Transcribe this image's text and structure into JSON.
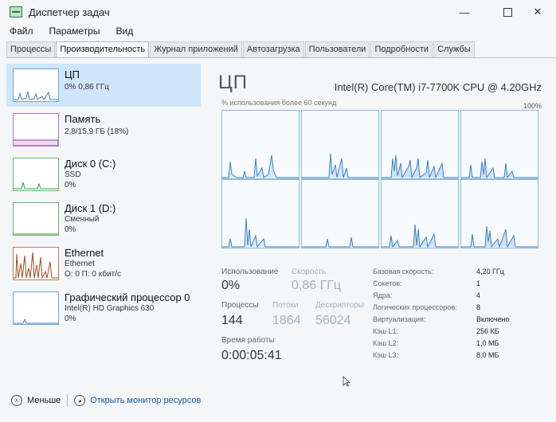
{
  "window": {
    "title": "Диспетчер задач"
  },
  "menu": [
    "Файл",
    "Параметры",
    "Вид"
  ],
  "tabs": [
    "Процессы",
    "Производительность",
    "Журнал приложений",
    "Автозагрузка",
    "Пользователи",
    "Подробности",
    "Службы"
  ],
  "active_tab": 1,
  "sidebar": [
    {
      "name": "ЦП",
      "lines": [
        "0% 0,86 ГГц"
      ],
      "active": true,
      "graph_color": "#3a7fc4"
    },
    {
      "name": "Память",
      "lines": [
        "2,8/15,9 ГБ (18%)"
      ],
      "graph_color": "#8b3aa0"
    },
    {
      "name": "Диск 0 (C:)",
      "lines": [
        "SSD",
        "0%"
      ],
      "graph_color": "#3e9a3e"
    },
    {
      "name": "Диск 1 (D:)",
      "lines": [
        "Сменный",
        "0%"
      ],
      "graph_color": "#3e9a3e"
    },
    {
      "name": "Ethernet",
      "lines": [
        "Ethernet",
        "О: 0 П: 0 кбит/с"
      ],
      "graph_color": "#a04a20"
    },
    {
      "name": "Графический процессор 0",
      "lines": [
        "Intel(R) HD Graphics 630",
        "0%"
      ],
      "graph_color": "#3a7fc4"
    }
  ],
  "main": {
    "title": "ЦП",
    "cpu_name": "Intel(R) Core(TM) i7-7700K CPU @ 4.20GHz",
    "graph_caption": "% использования более 60 секунд",
    "graph_max": "100%",
    "stats": {
      "usage_label": "Использование",
      "usage_value": "0%",
      "speed_label": "Скорость",
      "speed_value": "0,86 ГГц",
      "processes_label": "Процессы",
      "processes_value": "144",
      "threads_label": "Потоки",
      "threads_value": "1864",
      "handles_label": "Дескрипторы",
      "handles_value": "56024",
      "uptime_label": "Время работы",
      "uptime_value": "0:00:05:41"
    },
    "details": [
      {
        "label": "Базовая скорость:",
        "value": "4,20 ГГц"
      },
      {
        "label": "Сокетов:",
        "value": "1"
      },
      {
        "label": "Ядра:",
        "value": "4"
      },
      {
        "label": "Логических процессоров:",
        "value": "8"
      },
      {
        "label": "Виртуализация:",
        "value": "Включено"
      },
      {
        "label": "Кэш L1:",
        "value": "256 КБ"
      },
      {
        "label": "Кэш L2:",
        "value": "1,0 МБ"
      },
      {
        "label": "Кэш L3:",
        "value": "8,0 МБ"
      }
    ]
  },
  "footer": {
    "less_label": "Меньше",
    "monitor_label": "Открыть монитор ресурсов"
  }
}
